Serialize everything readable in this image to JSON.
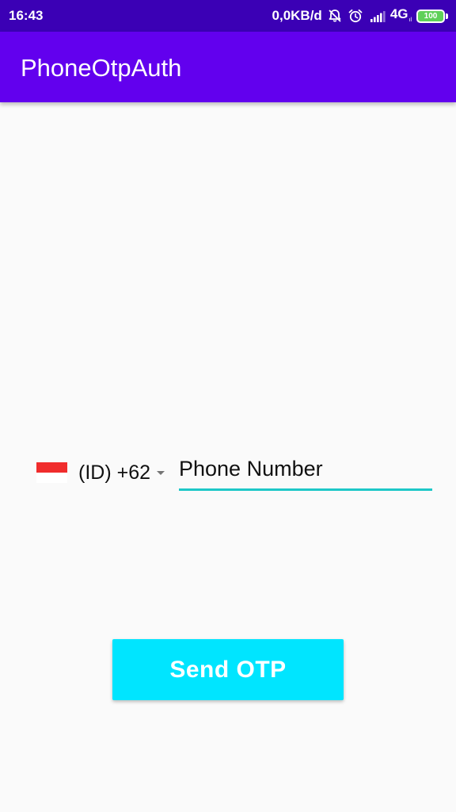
{
  "status_bar": {
    "time": "16:43",
    "net_speed": "0,0KB/d",
    "network_type": "4G",
    "network_sub": "ıl",
    "battery": "100",
    "icons": [
      "mute-icon",
      "alarm-icon",
      "signal-icon",
      "battery-icon"
    ]
  },
  "app_bar": {
    "title": "PhoneOtpAuth"
  },
  "phone_form": {
    "country_code": "(ID) +62",
    "flag": "indonesia-flag-icon",
    "phone_placeholder": "Phone Number",
    "phone_value": ""
  },
  "actions": {
    "send_label": "Send OTP"
  },
  "colors": {
    "status_bar": "#3b00b5",
    "app_bar": "#6200ee",
    "accent": "#1ec8c8",
    "button": "#00e5ff",
    "background": "#fafafa"
  }
}
